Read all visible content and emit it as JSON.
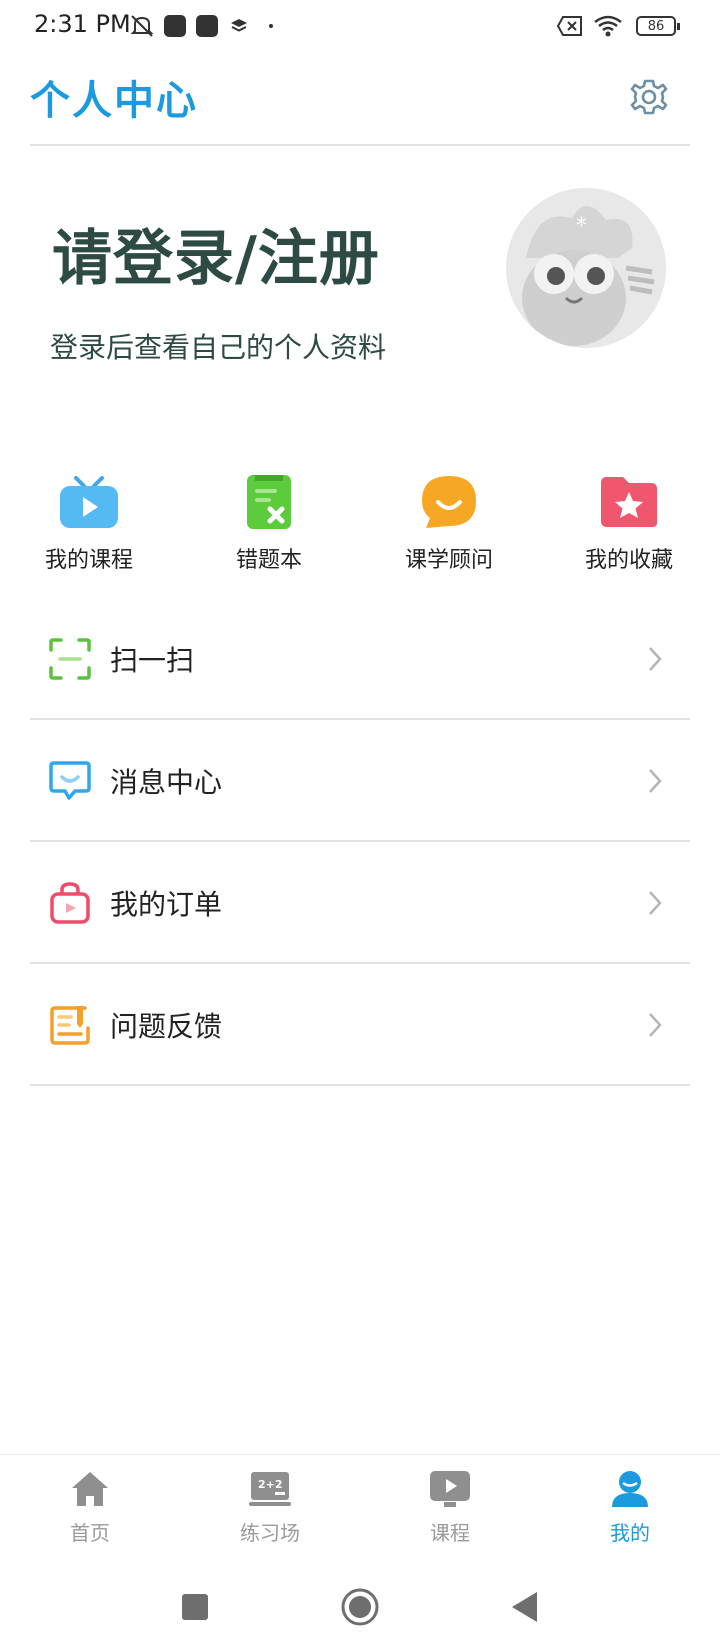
{
  "status_bar": {
    "time": "2:31 PM",
    "battery": "86",
    "icons": [
      "mute-icon",
      "app-notification-icon",
      "app-notification-icon",
      "layers-icon",
      "dot-icon",
      "sim-off-icon",
      "wifi-icon",
      "battery-icon"
    ]
  },
  "header": {
    "title": "个人中心",
    "settings_icon": "gear-icon"
  },
  "login": {
    "title": "请登录/注册",
    "subtitle": "登录后查看自己的个人资料",
    "avatar_icon": "mascot-avatar-icon"
  },
  "shortcuts": [
    {
      "label": "我的课程",
      "icon": "tv-play-icon",
      "color": "#4ab6f2"
    },
    {
      "label": "错题本",
      "icon": "notebook-x-icon",
      "color": "#5ccb3c"
    },
    {
      "label": "课学顾问",
      "icon": "chat-smile-icon",
      "color": "#f6a825"
    },
    {
      "label": "我的收藏",
      "icon": "star-folder-icon",
      "color": "#f0566e"
    }
  ],
  "menu": [
    {
      "label": "扫一扫",
      "icon": "scan-icon",
      "color": "#5cc13e"
    },
    {
      "label": "消息中心",
      "icon": "message-icon",
      "color": "#2ea7ef"
    },
    {
      "label": "我的订单",
      "icon": "shopping-bag-icon",
      "color": "#ee4c69"
    },
    {
      "label": "问题反馈",
      "icon": "feedback-icon",
      "color": "#f2a12a"
    }
  ],
  "tabs": [
    {
      "label": "首页",
      "icon": "home-icon",
      "active": false
    },
    {
      "label": "练习场",
      "icon": "blackboard-icon",
      "active": false
    },
    {
      "label": "课程",
      "icon": "video-course-icon",
      "active": false
    },
    {
      "label": "我的",
      "icon": "person-icon",
      "active": true
    }
  ],
  "colors": {
    "accent": "#1b9ae0",
    "title_dark": "#2e4a45",
    "inactive_tab": "#9a9a9a"
  }
}
